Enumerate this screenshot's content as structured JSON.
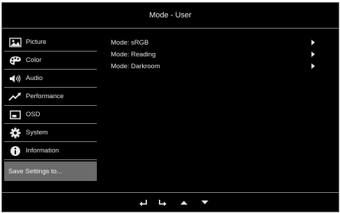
{
  "header": {
    "title": "Mode - User"
  },
  "sidebar": {
    "items": [
      {
        "label": "Picture",
        "icon": "picture-icon"
      },
      {
        "label": "Color",
        "icon": "palette-icon"
      },
      {
        "label": "Audio",
        "icon": "speaker-icon"
      },
      {
        "label": "Performance",
        "icon": "trend-icon"
      },
      {
        "label": "OSD",
        "icon": "osd-icon"
      },
      {
        "label": "System",
        "icon": "gear-icon"
      },
      {
        "label": "Information",
        "icon": "info-icon"
      }
    ],
    "selected": {
      "label": "Save Settings to..."
    }
  },
  "main": {
    "modes": [
      {
        "label": "Mode: sRGB"
      },
      {
        "label": "Mode: Reading"
      },
      {
        "label": "Mode: Darkroom"
      }
    ]
  },
  "footer": {
    "buttons": [
      {
        "icon": "back-icon"
      },
      {
        "icon": "enter-icon"
      },
      {
        "icon": "up-arrow-icon"
      },
      {
        "icon": "down-arrow-icon"
      }
    ]
  },
  "colors": {
    "background": "#000000",
    "selected": "#6b6b6b",
    "divider": "#8a8a8a",
    "text": "#e6e6e6"
  }
}
